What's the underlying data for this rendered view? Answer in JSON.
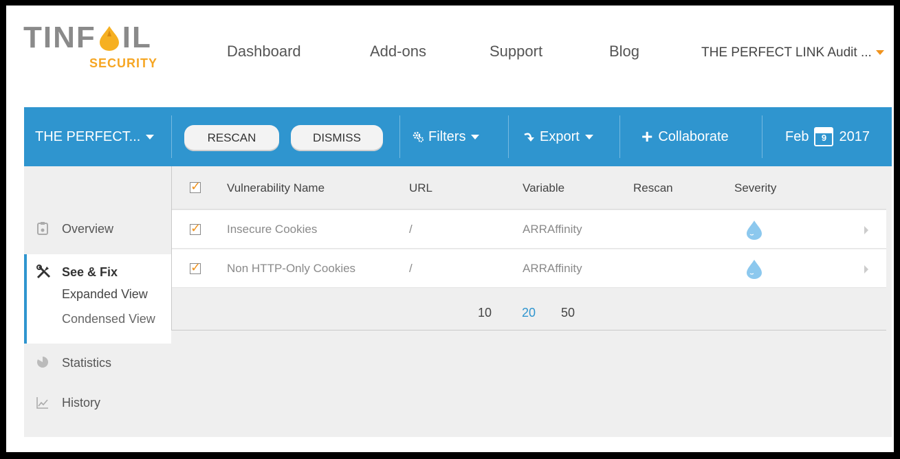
{
  "logo": {
    "main": "TINF",
    "main_end": "IL",
    "sub": "SECURITY"
  },
  "nav": {
    "dashboard": "Dashboard",
    "addons": "Add-ons",
    "support": "Support",
    "blog": "Blog",
    "account": "THE PERFECT LINK Audit ..."
  },
  "toolbar": {
    "site": "THE PERFECT...",
    "rescan": "RESCAN",
    "dismiss": "DISMISS",
    "filters": "Filters",
    "export": "Export",
    "collaborate": "Collaborate",
    "date_month": "Feb",
    "date_day": "9",
    "date_year": "2017"
  },
  "sidebar": {
    "overview": "Overview",
    "see_fix": "See & Fix",
    "expanded": "Expanded View",
    "condensed": "Condensed View",
    "statistics": "Statistics",
    "history": "History"
  },
  "table": {
    "headers": {
      "name": "Vulnerability Name",
      "url": "URL",
      "variable": "Variable",
      "rescan": "Rescan",
      "severity": "Severity"
    },
    "rows": [
      {
        "name": "Insecure Cookies",
        "url": "/",
        "variable": "ARRAffinity",
        "rescan": ""
      },
      {
        "name": "Non HTTP-Only Cookies",
        "url": "/",
        "variable": "ARRAffinity",
        "rescan": ""
      }
    ],
    "page_sizes": [
      "10",
      "20",
      "50"
    ],
    "active_page_size": "20"
  },
  "colors": {
    "accent": "#2f95cf",
    "orange": "#f0931e",
    "severity": "#8cc8ee"
  }
}
